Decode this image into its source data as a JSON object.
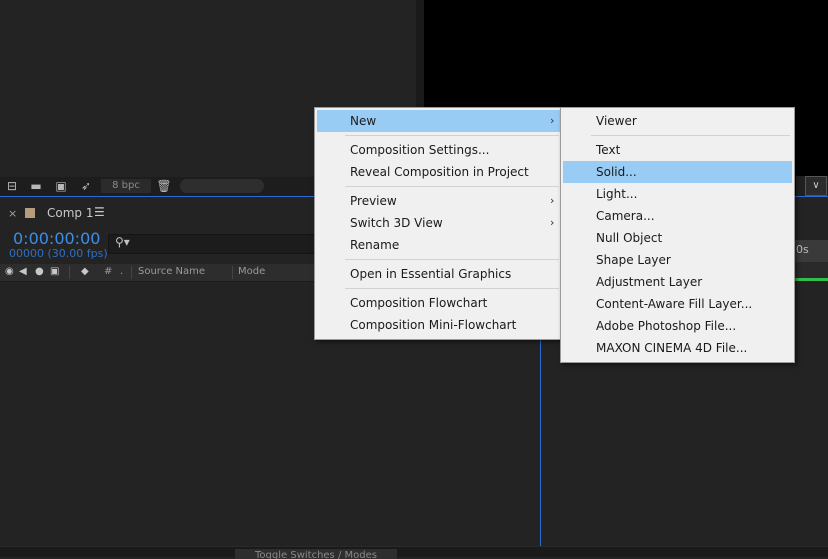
{
  "project_toolbar": {
    "bpc_label": "8 bpc"
  },
  "timeline": {
    "tab_label": "Comp 1",
    "tab_close_glyph": "×",
    "tab_menu_glyph": "☰",
    "timecode": "0:00:00:00",
    "timecode_sub": "00000 (30.00 fps)",
    "search_glyph": "⚲▾",
    "columns": {
      "hash": "#",
      "source_name": "Source Name",
      "mode": "Mode"
    }
  },
  "right_panel": {
    "ruler_label": "0s",
    "dropdown_glyph": "∨"
  },
  "bottom_bar": {
    "toggle_label": "Toggle Switches / Modes"
  },
  "context_menu": {
    "items": [
      {
        "label": "New",
        "submenu": true
      },
      {
        "label": "Composition Settings..."
      },
      {
        "label": "Reveal Composition in Project"
      },
      {
        "label": "Preview",
        "submenu": true
      },
      {
        "label": "Switch 3D View",
        "submenu": true
      },
      {
        "label": "Rename"
      },
      {
        "label": "Open in Essential Graphics"
      },
      {
        "label": "Composition Flowchart"
      },
      {
        "label": "Composition Mini-Flowchart"
      }
    ],
    "arrow_glyph": "›"
  },
  "new_submenu": {
    "items": [
      {
        "label": "Viewer"
      },
      {
        "label": "Text"
      },
      {
        "label": "Solid..."
      },
      {
        "label": "Light..."
      },
      {
        "label": "Camera..."
      },
      {
        "label": "Null Object"
      },
      {
        "label": "Shape Layer"
      },
      {
        "label": "Adjustment Layer"
      },
      {
        "label": "Content-Aware Fill Layer..."
      },
      {
        "label": "Adobe Photoshop File..."
      },
      {
        "label": "MAXON CINEMA 4D File..."
      }
    ]
  },
  "colors": {
    "highlight": "#99ccf5",
    "timecode": "#3c8fe8",
    "accent_line": "#2c6bd1"
  }
}
